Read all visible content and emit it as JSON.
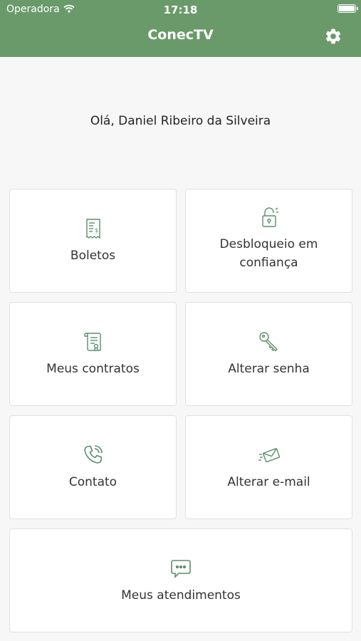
{
  "status_bar": {
    "carrier": "Operadora",
    "time": "17:18"
  },
  "header": {
    "title": "ConecTV"
  },
  "greeting": "Olá, Daniel Ribeiro da Silveira",
  "menu": {
    "items": [
      {
        "label": "Boletos",
        "icon": "receipt-icon"
      },
      {
        "label": "Desbloqueio em confiança",
        "icon": "unlock-icon"
      },
      {
        "label": "Meus contratos",
        "icon": "contract-icon"
      },
      {
        "label": "Alterar senha",
        "icon": "key-icon"
      },
      {
        "label": "Contato",
        "icon": "phone-icon"
      },
      {
        "label": "Alterar e-mail",
        "icon": "envelope-icon"
      },
      {
        "label": "Meus atendimentos",
        "icon": "chat-bubble-icon"
      }
    ]
  },
  "colors": {
    "primary": "#6a9a6a",
    "icon": "#5b8f6a",
    "background": "#f7f7f7"
  }
}
